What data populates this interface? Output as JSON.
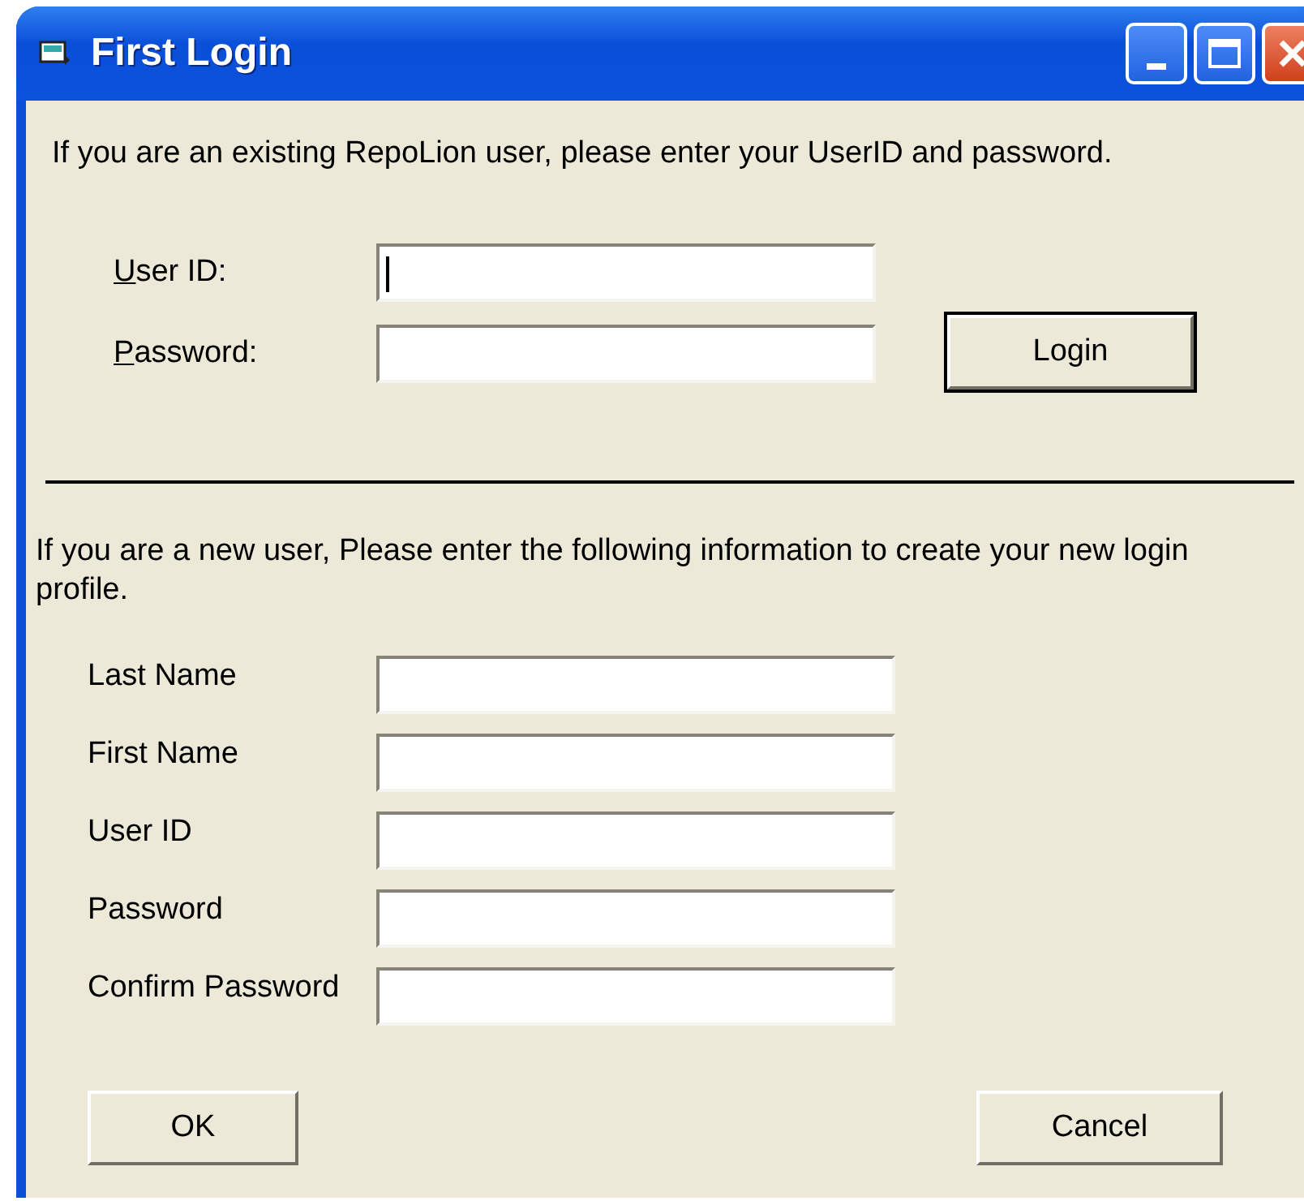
{
  "window": {
    "title": "First Login"
  },
  "existing_user": {
    "instructions": "If you are an existing RepoLion user, please enter your UserID and password.",
    "fields": [
      {
        "label": "User ID:",
        "underline_first_letter": true,
        "focused": true
      },
      {
        "label": "Password:",
        "underline_first_letter": true,
        "focused": false
      }
    ],
    "login_button": {
      "label": "Login",
      "default": true
    }
  },
  "new_user": {
    "instructions": "If you are a new user, Please enter the following information to create your new login profile.",
    "fields": [
      {
        "label": "Last Name"
      },
      {
        "label": "First Name"
      },
      {
        "label": "User ID"
      },
      {
        "label": "Password"
      },
      {
        "label": "Confirm Password"
      }
    ]
  },
  "buttons": [
    {
      "label": "OK",
      "default": false
    },
    {
      "label": "Cancel",
      "default": false
    }
  ]
}
